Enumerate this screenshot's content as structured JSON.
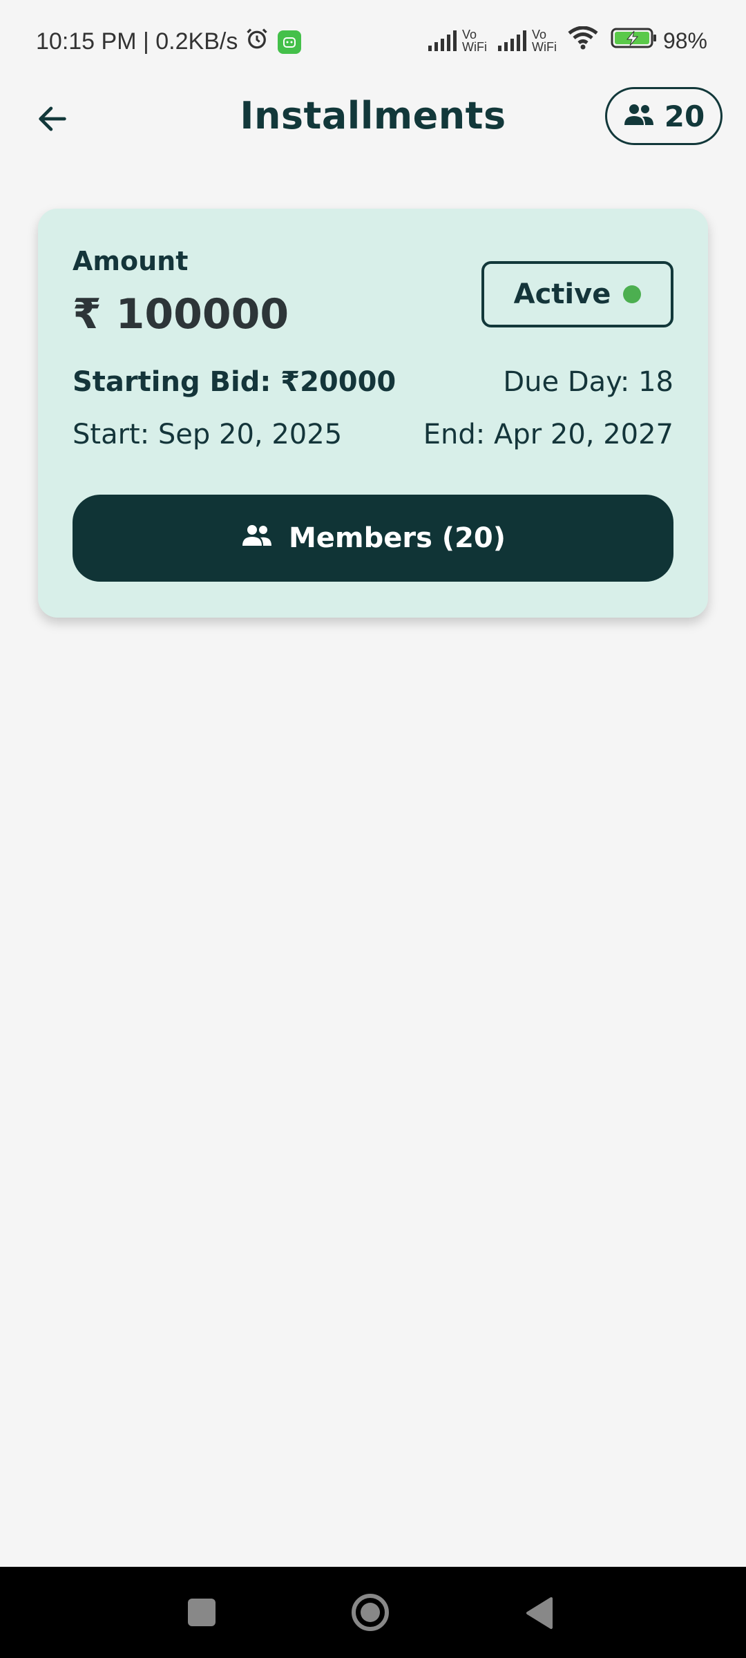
{
  "status_bar": {
    "time_speed": "10:15 PM | 0.2KB/s",
    "vo_wifi_1": "Vo\nWiFi",
    "vo_wifi_2": "Vo\nWiFi",
    "battery": "98%"
  },
  "header": {
    "title": "Installments",
    "members_count": "20",
    "back_icon": "arrow-back-icon",
    "members_icon": "people-icon"
  },
  "card": {
    "amount_label": "Amount",
    "amount_value": "₹ 100000",
    "status_label": "Active",
    "status_color": "#4caf50",
    "starting_bid": "Starting Bid: ₹20000",
    "due_day": "Due Day: 18",
    "start_date": "Start: Sep 20, 2025",
    "end_date": "End: Apr 20, 2027",
    "members_button_label": "Members (20)",
    "background": "#d8efe9",
    "accent": "#103436"
  },
  "nav_bar": {
    "recents_icon": "square-icon",
    "home_icon": "circle-icon",
    "back_icon": "triangle-back-icon"
  }
}
